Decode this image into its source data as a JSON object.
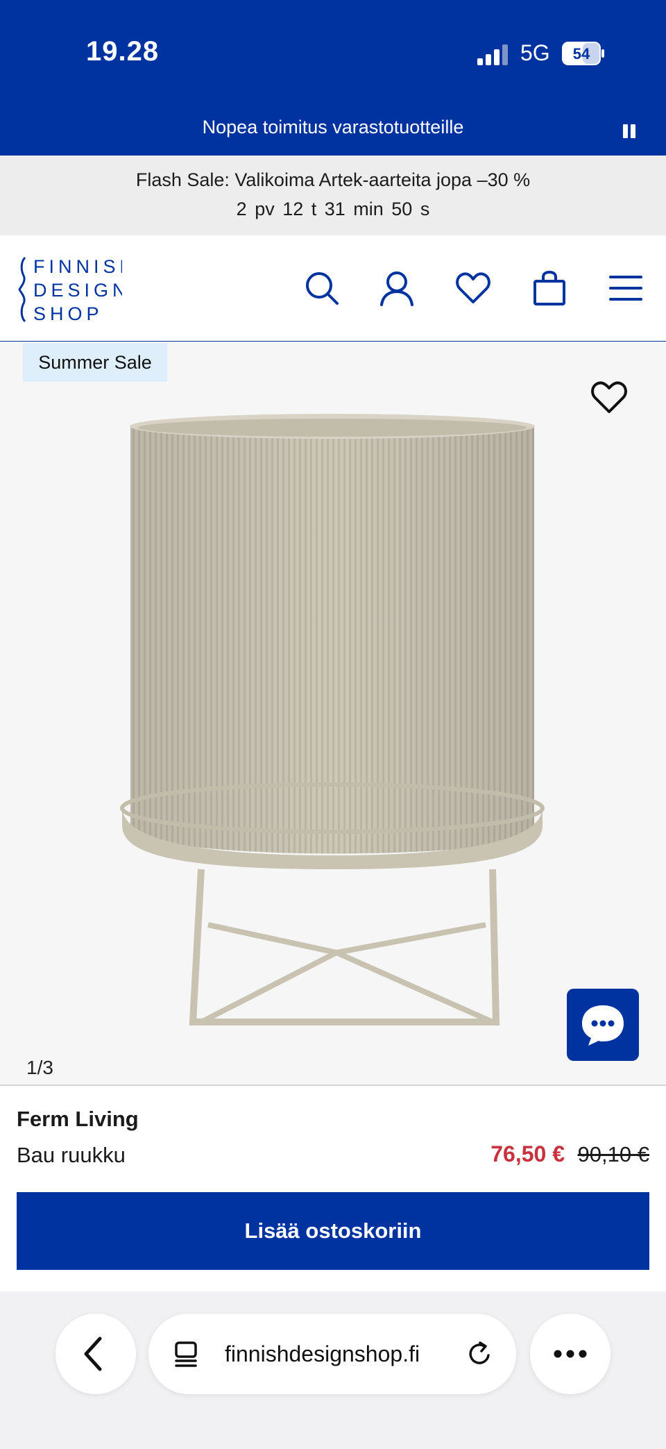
{
  "status_bar": {
    "time": "19.28",
    "network": "5G",
    "battery": "54"
  },
  "promo": {
    "text": "Nopea toimitus varastotuotteille"
  },
  "flash_sale": {
    "title": "Flash Sale: Valikoima Artek-aarteita jopa –30 %",
    "countdown": "2 pv  12 t  31 min  50 s"
  },
  "header": {
    "logo_lines": [
      "FINNISH",
      "DESIGN",
      "SHOP"
    ]
  },
  "gallery": {
    "badge": "Summer Sale",
    "counter": "1/3"
  },
  "product": {
    "brand": "Ferm Living",
    "name": "Bau ruukku",
    "sale_price": "76,50 €",
    "original_price": "90,10 €",
    "add_to_cart": "Lisää ostoskoriin"
  },
  "browser": {
    "url": "finnishdesignshop.fi"
  },
  "colors": {
    "brand_blue": "#0033a0",
    "sale_red": "#c8323d",
    "product_beige": "#cdc7b6"
  }
}
